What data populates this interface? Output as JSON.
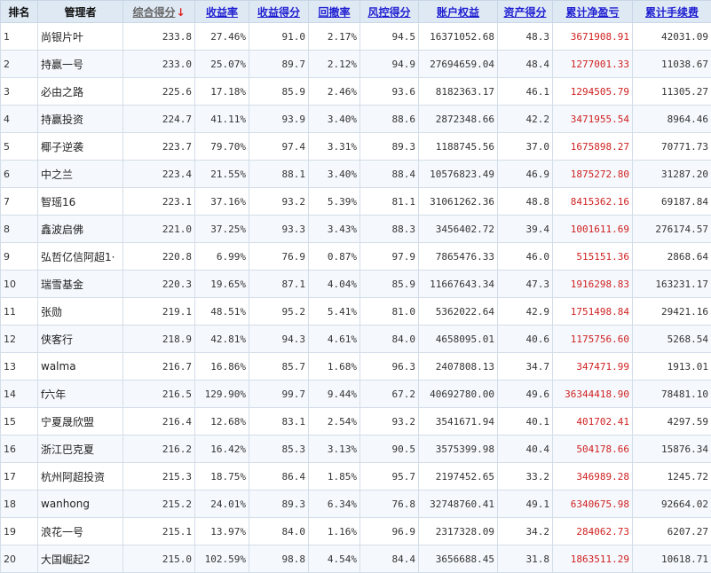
{
  "columns": [
    {
      "label": "排名",
      "style": "plain",
      "link": false
    },
    {
      "label": "管理者",
      "style": "plain",
      "link": false
    },
    {
      "label": "综合得分",
      "style": "sorted",
      "link": true,
      "sort_arrow": "↓"
    },
    {
      "label": "收益率",
      "style": "link",
      "link": true
    },
    {
      "label": "收益得分",
      "style": "link",
      "link": true
    },
    {
      "label": "回撤率",
      "style": "link",
      "link": true
    },
    {
      "label": "风控得分",
      "style": "link",
      "link": true
    },
    {
      "label": "账户权益",
      "style": "link",
      "link": true
    },
    {
      "label": "资产得分",
      "style": "link",
      "link": true
    },
    {
      "label": "累计净盈亏",
      "style": "link",
      "link": true
    },
    {
      "label": "累计手续费",
      "style": "link",
      "link": true
    }
  ],
  "colors": {
    "header_bg": "#dfe9f4",
    "header_link": "#1f1fd1",
    "profit_red": "#d02020"
  },
  "rows": [
    [
      "1",
      "尚银片叶",
      "233.8",
      "27.46%",
      "91.0",
      "2.17%",
      "94.5",
      "16371052.68",
      "48.3",
      "3671908.91",
      "42031.09"
    ],
    [
      "2",
      "持赢一号",
      "233.0",
      "25.07%",
      "89.7",
      "2.12%",
      "94.9",
      "27694659.04",
      "48.4",
      "1277001.33",
      "11038.67"
    ],
    [
      "3",
      "必由之路",
      "225.6",
      "17.18%",
      "85.9",
      "2.46%",
      "93.6",
      "8182363.17",
      "46.1",
      "1294505.79",
      "11305.27"
    ],
    [
      "4",
      "持赢投资",
      "224.7",
      "41.11%",
      "93.9",
      "3.40%",
      "88.6",
      "2872348.66",
      "42.2",
      "3471955.54",
      "8964.46"
    ],
    [
      "5",
      "椰子逆袭",
      "223.7",
      "79.70%",
      "97.4",
      "3.31%",
      "89.3",
      "1188745.56",
      "37.0",
      "1675898.27",
      "70771.73"
    ],
    [
      "6",
      "中之兰",
      "223.4",
      "21.55%",
      "88.1",
      "3.40%",
      "88.4",
      "10576823.49",
      "46.9",
      "1875272.80",
      "31287.20"
    ],
    [
      "7",
      "智瑶16",
      "223.1",
      "37.16%",
      "93.2",
      "5.39%",
      "81.1",
      "31061262.36",
      "48.8",
      "8415362.16",
      "69187.84"
    ],
    [
      "8",
      "鑫波启佛",
      "221.0",
      "37.25%",
      "93.3",
      "3.43%",
      "88.3",
      "3456402.72",
      "39.4",
      "1001611.69",
      "276174.57"
    ],
    [
      "9",
      "弘哲亿信阿超1·",
      "220.8",
      "6.99%",
      "76.9",
      "0.87%",
      "97.9",
      "7865476.33",
      "46.0",
      "515151.36",
      "2868.64"
    ],
    [
      "10",
      "瑞雪基金",
      "220.3",
      "19.65%",
      "87.1",
      "4.04%",
      "85.9",
      "11667643.34",
      "47.3",
      "1916298.83",
      "163231.17"
    ],
    [
      "11",
      "张勋",
      "219.1",
      "48.51%",
      "95.2",
      "5.41%",
      "81.0",
      "5362022.64",
      "42.9",
      "1751498.84",
      "29421.16"
    ],
    [
      "12",
      "侠客行",
      "218.9",
      "42.81%",
      "94.3",
      "4.61%",
      "84.0",
      "4658095.01",
      "40.6",
      "1175756.60",
      "5268.54"
    ],
    [
      "13",
      "walma",
      "216.7",
      "16.86%",
      "85.7",
      "1.68%",
      "96.3",
      "2407808.13",
      "34.7",
      "347471.99",
      "1913.01"
    ],
    [
      "14",
      "f六年",
      "216.5",
      "129.90%",
      "99.7",
      "9.44%",
      "67.2",
      "40692780.00",
      "49.6",
      "36344418.90",
      "78481.10"
    ],
    [
      "15",
      "宁夏晟欣盟",
      "216.4",
      "12.68%",
      "83.1",
      "2.54%",
      "93.2",
      "3541671.94",
      "40.1",
      "401702.41",
      "4297.59"
    ],
    [
      "16",
      "浙江巴克夏",
      "216.2",
      "16.42%",
      "85.3",
      "3.13%",
      "90.5",
      "3575399.98",
      "40.4",
      "504178.66",
      "15876.34"
    ],
    [
      "17",
      "杭州阿超投资",
      "215.3",
      "18.75%",
      "86.4",
      "1.85%",
      "95.7",
      "2197452.65",
      "33.2",
      "346989.28",
      "1245.72"
    ],
    [
      "18",
      "wanhong",
      "215.2",
      "24.01%",
      "89.3",
      "6.34%",
      "76.8",
      "32748760.41",
      "49.1",
      "6340675.98",
      "92664.02"
    ],
    [
      "19",
      "浪花一号",
      "215.1",
      "13.97%",
      "84.0",
      "1.16%",
      "96.9",
      "2317328.09",
      "34.2",
      "284062.73",
      "6207.27"
    ],
    [
      "20",
      "大国崛起2",
      "215.0",
      "102.59%",
      "98.8",
      "4.54%",
      "84.4",
      "3656688.45",
      "31.8",
      "1863511.29",
      "10618.71"
    ]
  ]
}
